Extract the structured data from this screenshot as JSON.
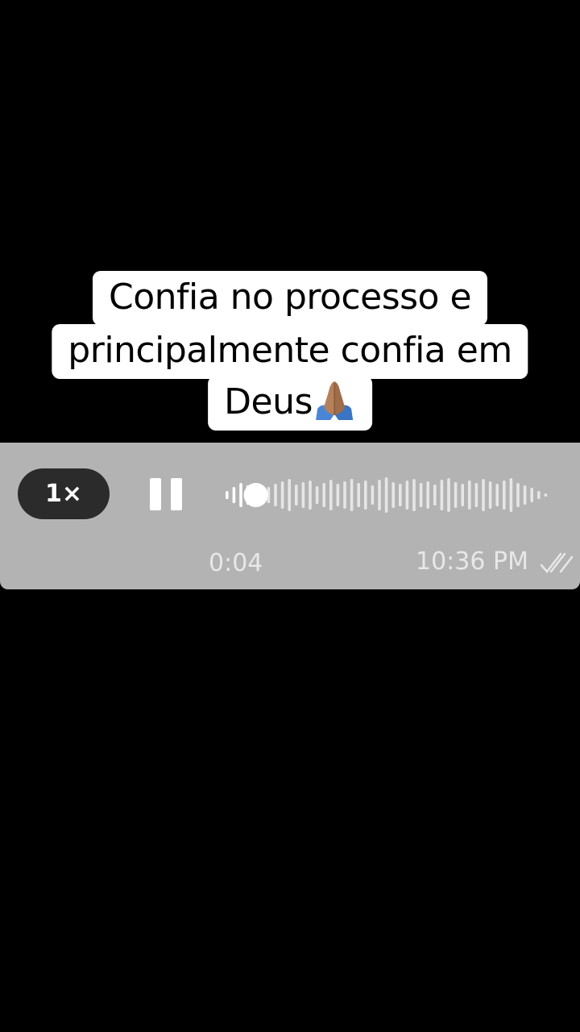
{
  "caption": {
    "line1": "Confia no processo e",
    "line2": "principalmente confia em",
    "line3": "Deus",
    "emoji": "folded-hands-icon"
  },
  "voice_message": {
    "speed_label": "1×",
    "state_icon": "pause-icon",
    "elapsed": "0:04",
    "sent_time": "10:36 PM",
    "status_icon": "double-check-icon",
    "progress_fraction": 0.08,
    "colors": {
      "bar_background": "#b3b3b3",
      "pill_background": "#2b2b2b",
      "played_wave": "#ffffff",
      "unplayed_wave": "#e6e6e6"
    }
  }
}
